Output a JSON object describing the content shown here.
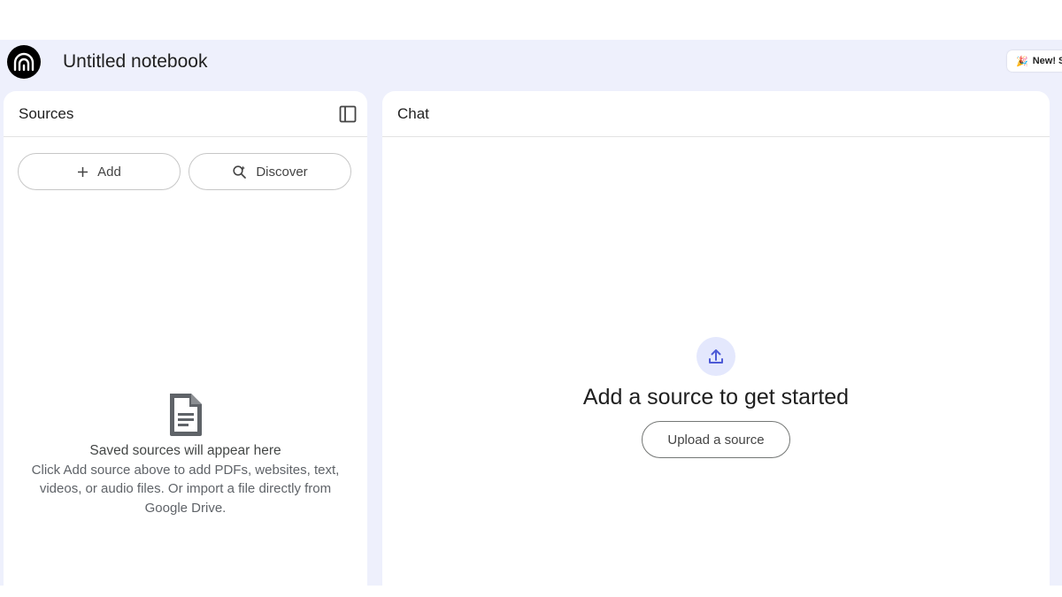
{
  "header": {
    "title": "Untitled notebook",
    "promo_label": "New! S",
    "promo_emoji": "🎉"
  },
  "sources": {
    "title": "Sources",
    "add_label": "Add",
    "discover_label": "Discover",
    "empty_heading": "Saved sources will appear here",
    "empty_body": "Click Add source above to add PDFs, websites, text, videos, or audio files. Or import a file directly from Google Drive."
  },
  "chat": {
    "title": "Chat",
    "empty_heading": "Add a source to get started",
    "upload_label": "Upload a source"
  },
  "icons": {
    "logo": "notebooklm-logo-icon",
    "collapse": "sidebar-collapse-icon",
    "add": "plus-icon",
    "discover": "search-sparkle-icon",
    "document": "document-icon",
    "upload": "upload-icon"
  },
  "colors": {
    "background": "#eef0fc",
    "accent": "#4d5ad6",
    "upload_circle": "#e4e8fd"
  }
}
